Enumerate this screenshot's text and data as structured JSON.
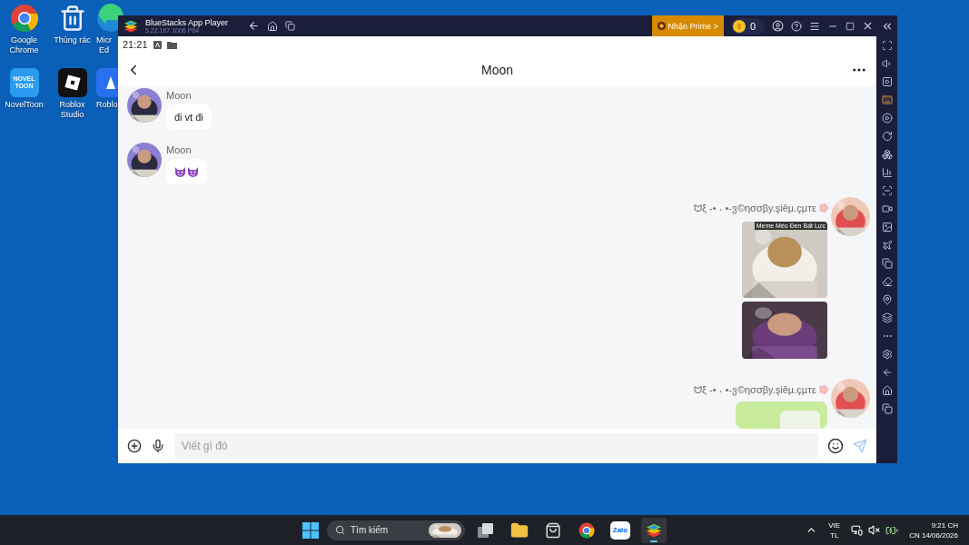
{
  "desktop": {
    "icons": [
      {
        "kind": "chrome",
        "lines": [
          "Google",
          "Chrome"
        ]
      },
      {
        "kind": "recycle",
        "lines": [
          "Thùng rác"
        ]
      },
      {
        "kind": "edge",
        "lines": [
          "Micr",
          "Ed"
        ]
      },
      {
        "kind": "noveltoon",
        "logo": "NOVEL TOON",
        "lines": [
          "NovelToon"
        ]
      },
      {
        "kind": "roblox",
        "lines": [
          "Roblox",
          "Studio"
        ]
      },
      {
        "kind": "roblox2",
        "lines": [
          "Roblo"
        ]
      }
    ]
  },
  "window": {
    "title": "BlueStacks App Player",
    "version": "5.22.167.1006 P64",
    "prime_button": "Nhận Prime >",
    "coins": "0"
  },
  "phone_status": {
    "time": "21:21"
  },
  "chat": {
    "title": "Moon",
    "messages": [
      {
        "outgoing": false,
        "sender": "Moon",
        "kind": "text",
        "text": "đi vt đi"
      },
      {
        "outgoing": false,
        "sender": "Moon",
        "kind": "emoji"
      },
      {
        "outgoing": true,
        "sender": "ᗢξ ‐• ˖ •‐ვ©ησσβy.şiêµ.çµтε",
        "kind": "stickers",
        "sticker_label": "Meme Mèo Đen Bất Lực"
      },
      {
        "outgoing": true,
        "sender": "ᗢξ ‐• ˖ •‐ვ©ησσβy.şiêµ.çµтε",
        "kind": "pending"
      }
    ]
  },
  "composer": {
    "placeholder": "Viết gì đó"
  },
  "taskbar": {
    "search_placeholder": "Tìm kiếm",
    "apps": [
      {
        "kind": "taskview",
        "selected": false
      },
      {
        "kind": "folder",
        "selected": false
      },
      {
        "kind": "store",
        "selected": false
      },
      {
        "kind": "chrome",
        "selected": false
      },
      {
        "kind": "zalo",
        "logo": "Zalo",
        "selected": false
      },
      {
        "kind": "bluestacks",
        "selected": true
      }
    ],
    "language": "VIE",
    "layout": "TL",
    "time": "9:21 CH",
    "date": "CN 14/06/2026"
  }
}
